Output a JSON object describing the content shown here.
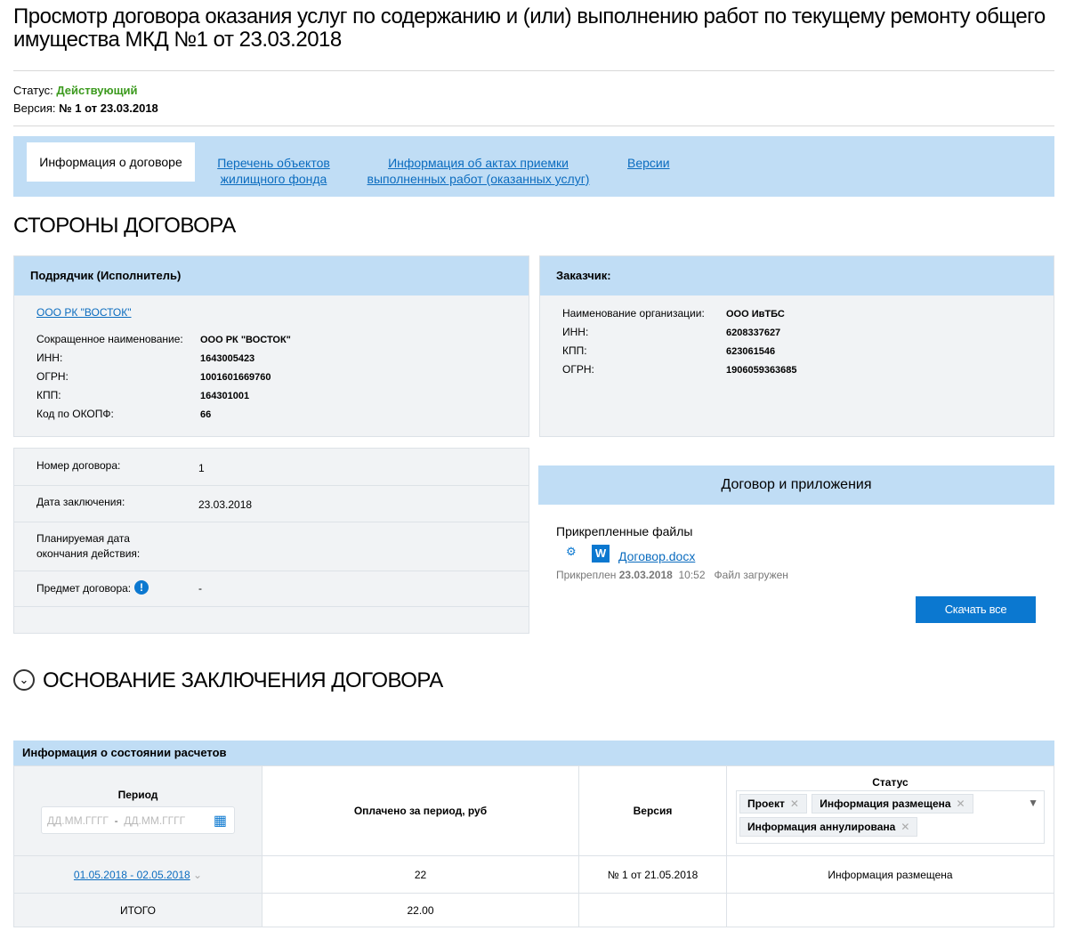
{
  "title": "Просмотр договора оказания услуг по содержанию и (или) выполнению работ по текущему ремонту общего имущества МКД №1 от 23.03.2018",
  "status": {
    "label": "Статус:",
    "value": "Действующий",
    "version_label": "Версия:",
    "version_value": "№ 1 от 23.03.2018"
  },
  "tabs": [
    "Информация о договоре",
    "Перечень объектов жилищного фонда",
    "Информация об актах приемки выполненных работ (оказанных услуг)",
    "Версии"
  ],
  "sides_title": "СТОРОНЫ ДОГОВОРА",
  "contractor": {
    "header": "Подрядчик (Исполнитель)",
    "link": "ООО РК \"ВОСТОК\"",
    "fields": [
      [
        "Сокращенное наименование:",
        "ООО РК \"ВОСТОК\""
      ],
      [
        "ИНН:",
        "1643005423"
      ],
      [
        "ОГРН:",
        "1001601669760"
      ],
      [
        "КПП:",
        "164301001"
      ],
      [
        "Код по ОКОПФ:",
        "66"
      ]
    ]
  },
  "customer": {
    "header": "Заказчик:",
    "fields": [
      [
        "Наименование организации:",
        "ООО ИвТБС"
      ],
      [
        "ИНН:",
        "6208337627"
      ],
      [
        "КПП:",
        "623061546"
      ],
      [
        "ОГРН:",
        "1906059363685"
      ]
    ]
  },
  "contract": {
    "rows": [
      [
        "Номер договора:",
        "1"
      ],
      [
        "Дата заключения:",
        "23.03.2018"
      ],
      [
        "Планируемая дата окончания действия:",
        ""
      ],
      [
        "Предмет договора:",
        "-"
      ]
    ]
  },
  "docs": {
    "header": "Договор и приложения",
    "attached": "Прикрепленные файлы",
    "file": "Договор.docx",
    "attached_label": "Прикреплен",
    "date": "23.03.2018",
    "time": "10:52",
    "file_status": "Файл загружен",
    "download": "Скачать все"
  },
  "basis_title": "ОСНОВАНИЕ ЗАКЛЮЧЕНИЯ ДОГОВОРА",
  "payments": {
    "header": "Информация о состоянии расчетов",
    "col_period": "Период",
    "date_placeholder_from": "ДД.ММ.ГГГГ",
    "date_sep": "-",
    "date_placeholder_to": "ДД.ММ.ГГГГ",
    "col_paid": "Оплачено за период, руб",
    "col_version": "Версия",
    "col_status": "Статус",
    "chips": [
      "Проект",
      "Информация размещена",
      "Информация аннулирована"
    ],
    "row": {
      "period": "01.05.2018 - 02.05.2018",
      "paid": "22",
      "version": "№ 1 от 21.05.2018",
      "status": "Информация размещена"
    },
    "total_label": "ИТОГО",
    "total": "22.00"
  }
}
